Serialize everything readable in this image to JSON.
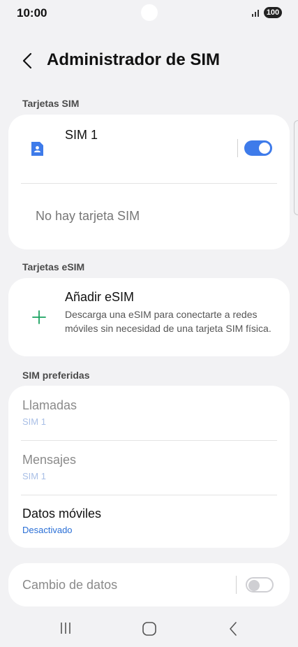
{
  "status": {
    "time": "10:00",
    "battery": "100"
  },
  "header": {
    "title": "Administrador de SIM"
  },
  "sections": {
    "sim_cards": "Tarjetas SIM",
    "esim_cards": "Tarjetas eSIM",
    "preferred": "SIM preferidas"
  },
  "sim1": {
    "name": "SIM 1",
    "toggle_on": true,
    "empty_slot": "No hay tarjeta SIM"
  },
  "esim": {
    "title": "Añadir eSIM",
    "description": "Descarga una eSIM para conectarte a redes móviles sin necesidad de una tarjeta SIM física."
  },
  "preferred": {
    "calls": {
      "label": "Llamadas",
      "value": "SIM 1"
    },
    "messages": {
      "label": "Mensajes",
      "value": "SIM 1"
    },
    "mobile_data": {
      "label": "Datos móviles",
      "value": "Desactivado"
    }
  },
  "data_switch": {
    "label": "Cambio de datos",
    "toggle_on": false
  },
  "colors": {
    "accent": "#3e7bea",
    "add_icon": "#1aa260",
    "disabled_text": "#8a8a8a",
    "disabled_sub": "#a9bfe6",
    "link": "#2a6fd6"
  },
  "icons": [
    "signal-icon",
    "back-arrow-icon",
    "sim-card-icon",
    "plus-icon",
    "recent-apps-icon",
    "home-icon",
    "nav-back-icon"
  ]
}
